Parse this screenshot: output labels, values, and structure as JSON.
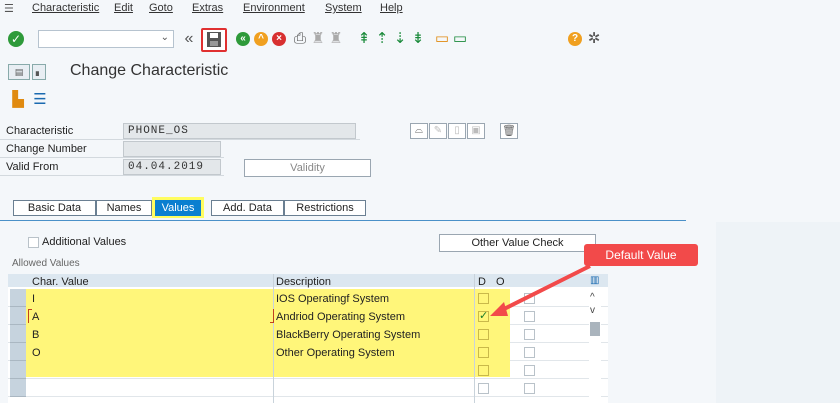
{
  "menu": {
    "items": [
      "Characteristic",
      "Edit",
      "Goto",
      "Extras",
      "Environment",
      "System",
      "Help"
    ]
  },
  "toolbar": {
    "command_value": "",
    "icons": [
      "check-icon",
      "back-double-icon",
      "save-icon",
      "back-icon",
      "exit-icon",
      "cancel-icon",
      "print-icon",
      "find-icon",
      "find-next-icon",
      "first-page-icon",
      "prev-page-icon",
      "next-page-icon",
      "last-page-icon",
      "create-session-icon",
      "shortcut-icon",
      "help-icon",
      "settings-icon"
    ]
  },
  "title": "Change Characteristic",
  "header": {
    "characteristic_label": "Characteristic",
    "characteristic_value": "PHONE_OS",
    "change_number_label": "Change Number",
    "change_number_value": "",
    "valid_from_label": "Valid From",
    "valid_from_value": "04.04.2019",
    "validity_button": "Validity"
  },
  "tabs": [
    {
      "label": "Basic Data",
      "active": false
    },
    {
      "label": "Names",
      "active": false
    },
    {
      "label": "Values",
      "active": true
    },
    {
      "label": "Add. Data",
      "active": false
    },
    {
      "label": "Restrictions",
      "active": false
    }
  ],
  "values_tab": {
    "additional_values_label": "Additional Values",
    "other_value_check_button": "Other Value Check",
    "allowed_values_label": "Allowed Values",
    "columns": {
      "char_value": "Char. Value",
      "description": "Description",
      "d": "D",
      "o": "O"
    },
    "rows": [
      {
        "value": "I",
        "description": "IOS Operatingf System",
        "default": false
      },
      {
        "value": "A",
        "description": "Andriod Operating System",
        "default": true
      },
      {
        "value": "B",
        "description": "BlackBerry Operating System",
        "default": false
      },
      {
        "value": "O",
        "description": "Other Operating System",
        "default": false
      },
      {
        "value": "",
        "description": "",
        "default": false
      },
      {
        "value": "",
        "description": "",
        "default": false
      }
    ]
  },
  "callout": {
    "text": "Default Value"
  },
  "colors": {
    "highlight": "#fff67a",
    "callout": "#f24a4a",
    "active_tab": "#0a7fd0",
    "save_highlight": "#e03030"
  }
}
